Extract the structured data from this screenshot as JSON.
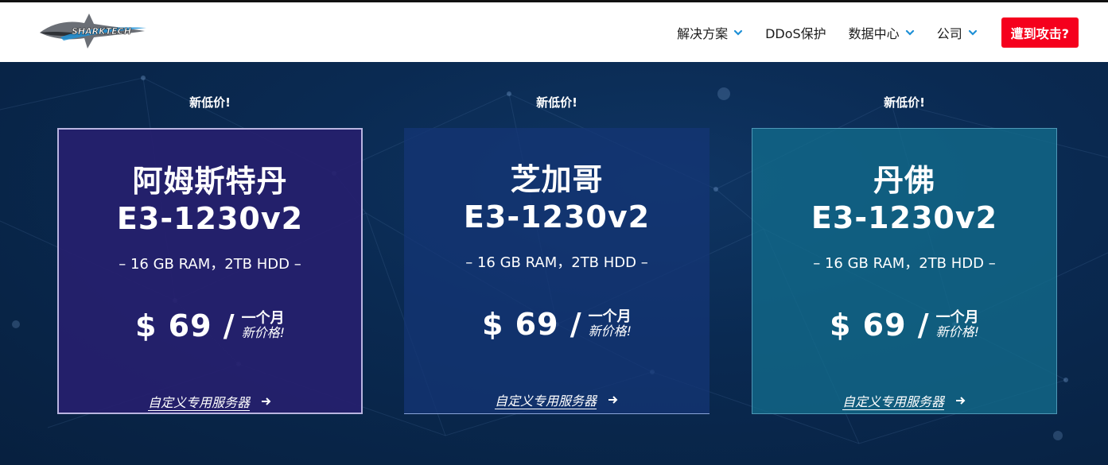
{
  "header": {
    "logo_text": "SHARKTECH",
    "nav": [
      {
        "label": "解决方案",
        "has_dropdown": true
      },
      {
        "label": "DDoS保护",
        "has_dropdown": false
      },
      {
        "label": "数据中心",
        "has_dropdown": true
      },
      {
        "label": "公司",
        "has_dropdown": true
      }
    ],
    "cta_label": "遭到攻击?"
  },
  "colors": {
    "accent_blue": "#1e90d6",
    "cta_red": "#f5001d"
  },
  "offers": [
    {
      "tag": "新低价!",
      "city": "阿姆斯特丹",
      "model": "E3-1230v2",
      "specs": "–   16 GB RAM，2TB HDD –",
      "price": "$ 69 /",
      "period": "一个月",
      "price_note": "新价格!",
      "link_label": "自定义专用服务器"
    },
    {
      "tag": "新低价!",
      "city": "芝加哥",
      "model": "E3-1230v2",
      "specs": "–   16 GB RAM，2TB HDD –",
      "price": "$ 69 /",
      "period": "一个月",
      "price_note": "新价格!",
      "link_label": "自定义专用服务器"
    },
    {
      "tag": "新低价!",
      "city": "丹佛",
      "model": "E3-1230v2",
      "specs": "–   16 GB RAM，2TB HDD –",
      "price": "$ 69 /",
      "period": "一个月",
      "price_note": "新价格!",
      "link_label": "自定义专用服务器"
    }
  ]
}
